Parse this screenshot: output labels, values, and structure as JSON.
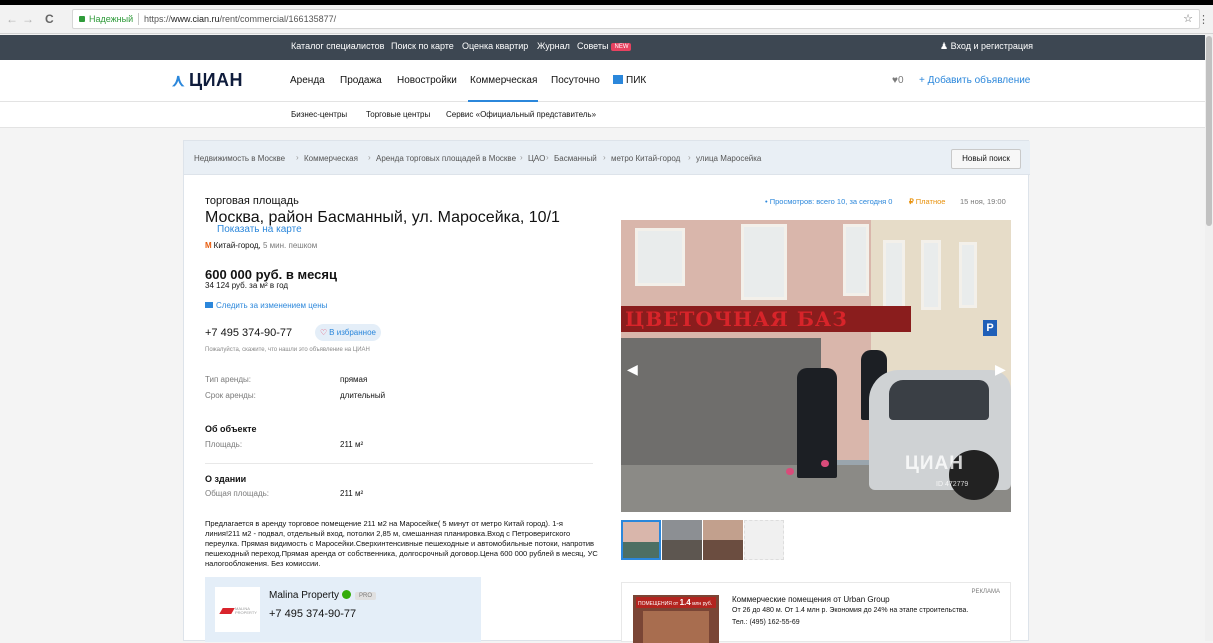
{
  "browser": {
    "secure_label": "Надежный",
    "url_prefix": "https://",
    "url_host": "www.cian.ru",
    "url_path": "/rent/commercial/166135877/",
    "nav_back": "←",
    "nav_forward": "→",
    "reload": "C",
    "star": "☆"
  },
  "topnav": {
    "items": [
      "Каталог специалистов",
      "Поиск по карте",
      "Оценка квартир",
      "Журнал",
      "Советы"
    ],
    "new_badge": "NEW",
    "login": "Вход и регистрация"
  },
  "header": {
    "logo": "ЦИАН",
    "nav": [
      "Аренда",
      "Продажа",
      "Новостройки",
      "Коммерческая",
      "Посуточно",
      "ПИК"
    ],
    "favorites_count": "0",
    "add_ad": "+ Добавить объявление"
  },
  "subnav": {
    "items": [
      "Бизнес-центры",
      "Торговые центры",
      "Сервис «Официальный представитель»"
    ]
  },
  "breadcrumbs": [
    "Недвижимость в Москве",
    "Коммерческая",
    "Аренда торговых площадей в Москве",
    "ЦАО",
    "Басманный",
    "метро Китай-город",
    "улица Маросейка"
  ],
  "new_search": "Новый поиск",
  "listing": {
    "object_type": "торговая площадь",
    "address": "Москва, район Басманный, ул. Маросейка, 10/1",
    "show_map": "Показать на карте",
    "metro_name": "Китай-город,",
    "metro_walk": "5 мин. пешком",
    "price": "600 000 руб. в месяц",
    "price_per_sqm": "34 124 руб. за м² в год",
    "follow_price": "Следить за изменением цены",
    "phone": "+7 495 374-90-77",
    "favorite_btn": "В избранное",
    "please_say": "Пожалуйста, скажите, что нашли это объявление на ЦИАН",
    "rent_type_label": "Тип аренды:",
    "rent_type_value": "прямая",
    "rent_term_label": "Срок аренды:",
    "rent_term_value": "длительный",
    "about_object": "Об объекте",
    "area_label": "Площадь:",
    "area_value": "211 м²",
    "about_building": "О здании",
    "total_area_label": "Общая площадь:",
    "total_area_value": "211 м²",
    "description": "Предлагается в аренду торговое помещение 211 м2 на Маросейке( 5 минут от метро Китай город). 1-я линия!211 м2 - подвал, отдельный вход, потолки 2,85 м, смешанная планировка.Вход с Петроверигского переулка. Прямая видимость с Маросейки.Сверхинтенсивные пешеходные и автомобильные потоки, напротив пешеходный переход.Прямая аренда от собственника, долгосрочный договор.Цена 600 000 рублей в месяц, УС налогообложения. Без комиссии.",
    "views": "• Просмотров: всего 10, за сегодня 0",
    "paid": "Платное",
    "date": "15 ноя, 19:00"
  },
  "photo": {
    "sign_text": "ЦВЕТОЧНАЯ БАЗ",
    "parking_sign": "P",
    "watermark": "ЦИАН",
    "photo_id": "ID 472779"
  },
  "agent": {
    "logo_text": "MALINA PROPERTY",
    "name": "Malina Property",
    "pro": "PRO",
    "phone": "+7 495 374-90-77"
  },
  "ad": {
    "label_prefix": "ПОМЕЩЕНИЯ от",
    "label_price": "1.4",
    "label_suffix": "млн руб.",
    "title": "Коммерческие помещения от Urban Group",
    "reklama": "РЕКЛАМА",
    "text": "От 26 до 480 м. От 1.4 млн р. Экономия до 24% на этапе строительства.",
    "tel": "Тел.: (495) 162-55-69"
  },
  "colors": {
    "accent": "#2b87db",
    "topnav_bg": "#3d4752",
    "new_badge": "#e84260",
    "secure": "#2f9b3a",
    "paid": "#e8910c"
  }
}
